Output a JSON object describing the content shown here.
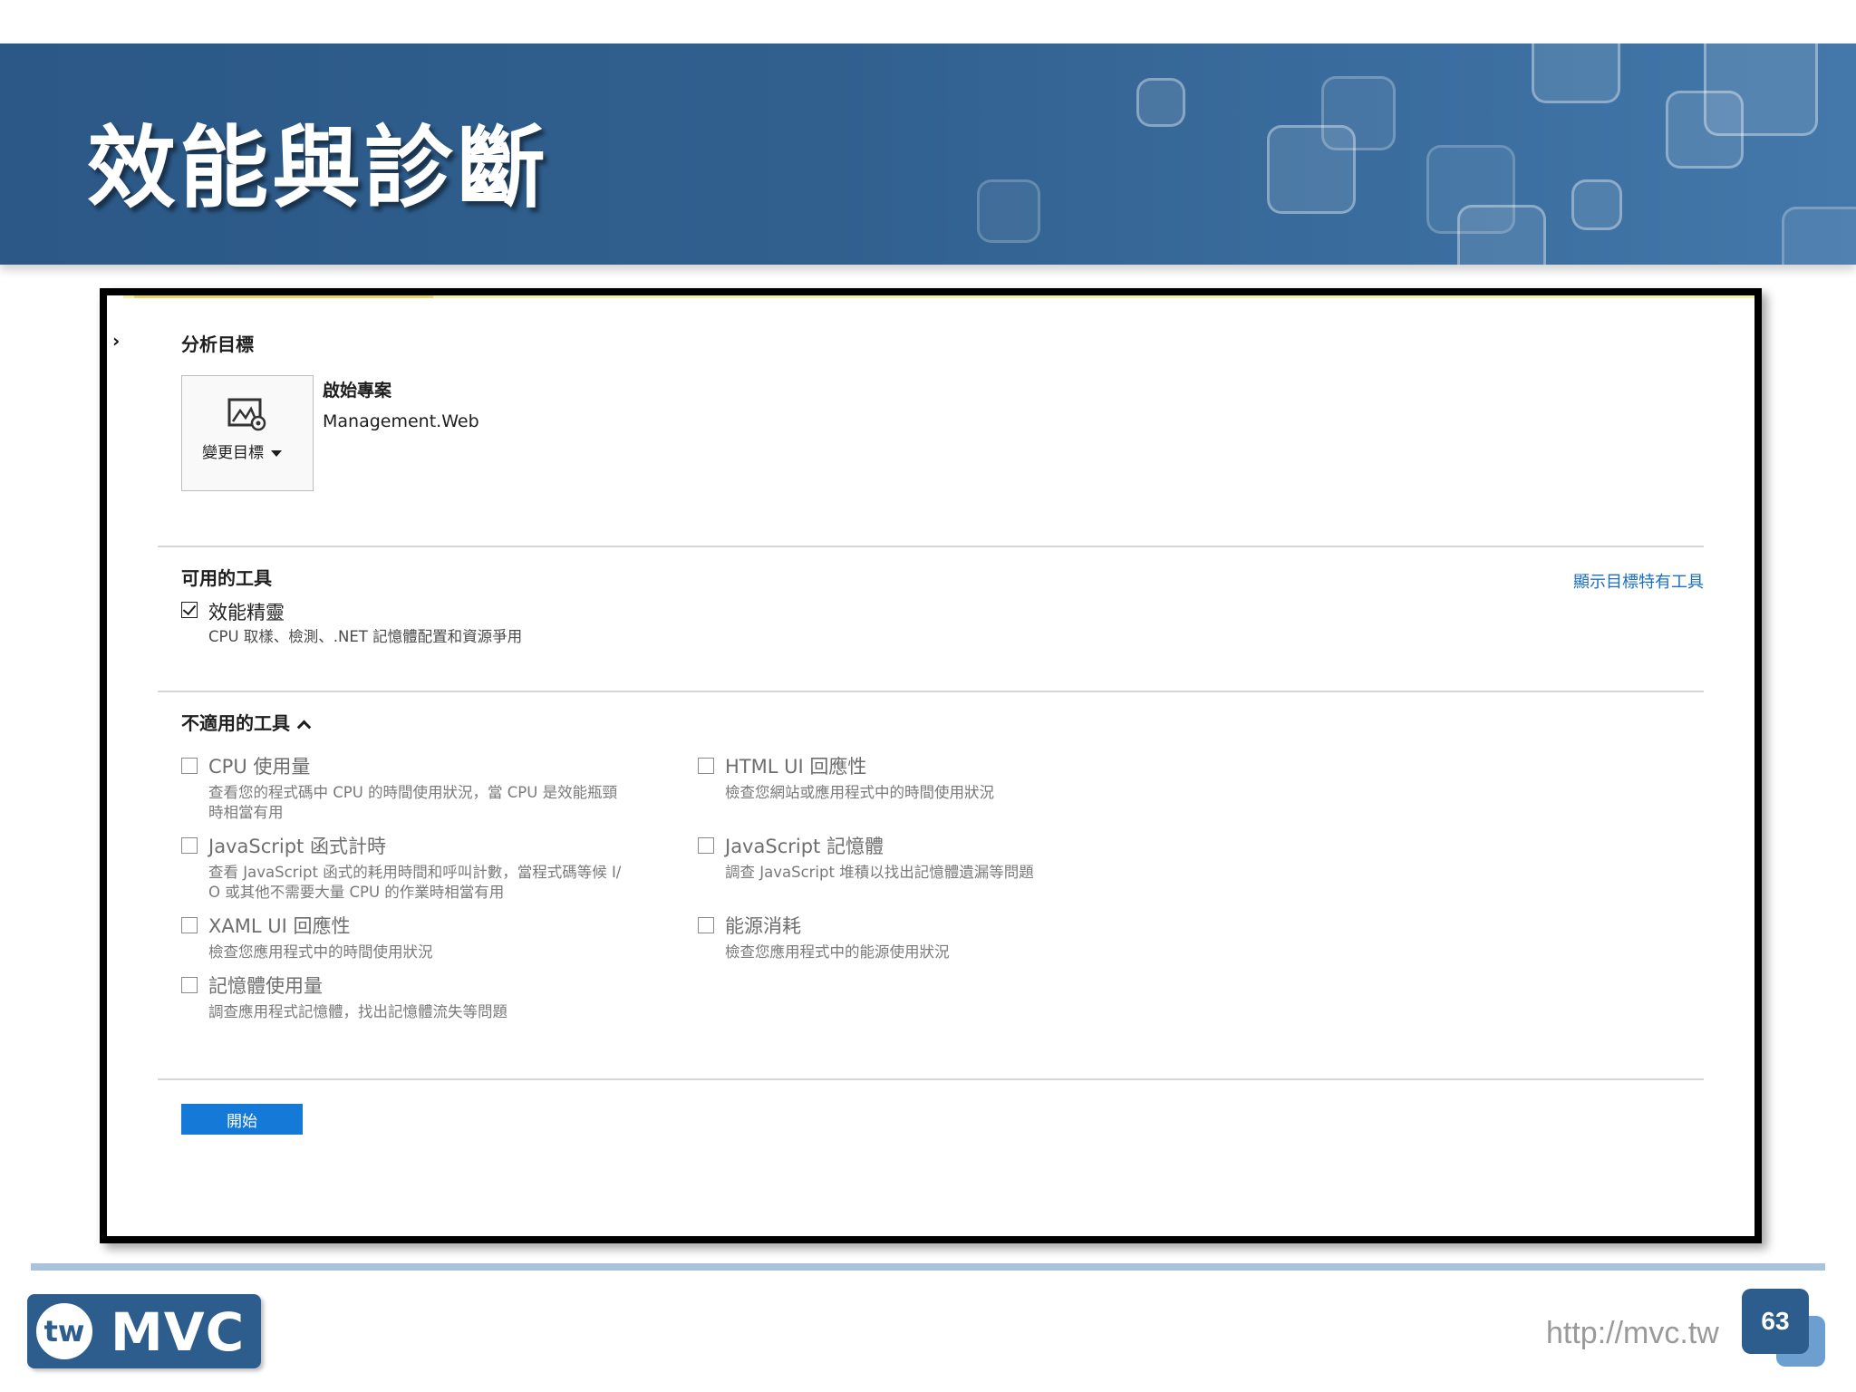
{
  "slide": {
    "title": "效能與診斷",
    "url": "http://mvc.tw",
    "page_number": "63",
    "logo_text": {
      "tw": "tw",
      "mvc": "MVC"
    }
  },
  "analysis_target": {
    "heading": "分析目標",
    "change_target_label": "變更目標",
    "startup_project_label": "啟始專案",
    "project_name": "Management.Web"
  },
  "available_tools": {
    "heading": "可用的工具",
    "show_all_link": "顯示目標特有工具",
    "items": [
      {
        "label": "效能精靈",
        "description": "CPU 取樣、檢測、.NET 記憶體配置和資源爭用",
        "checked": true
      }
    ]
  },
  "unavailable_tools": {
    "heading": "不適用的工具",
    "left_column": [
      {
        "label": "CPU 使用量",
        "description_lines": [
          "查看您的程式碼中 CPU 的時間使用狀況，當 CPU 是效能瓶頸",
          "時相當有用"
        ]
      },
      {
        "label": "JavaScript 函式計時",
        "description_lines": [
          "查看 JavaScript 函式的耗用時間和呼叫計數，當程式碼等候 I/",
          "O 或其他不需要大量 CPU 的作業時相當有用"
        ]
      },
      {
        "label": "XAML UI 回應性",
        "description_lines": [
          "檢查您應用程式中的時間使用狀況"
        ]
      },
      {
        "label": "記憶體使用量",
        "description_lines": [
          "調查應用程式記憶體，找出記憶體流失等問題"
        ]
      }
    ],
    "right_column": [
      {
        "label": "HTML UI 回應性",
        "description_lines": [
          "檢查您網站或應用程式中的時間使用狀況"
        ]
      },
      {
        "label": "JavaScript 記憶體",
        "description_lines": [
          "調查 JavaScript 堆積以找出記憶體遺漏等問題"
        ]
      },
      {
        "label": "能源消耗",
        "description_lines": [
          "檢查您應用程式中的能源使用狀況"
        ]
      }
    ]
  },
  "start_button_label": "開始",
  "colors": {
    "header_blue": "#2b5886",
    "accent_blue": "#1479d7",
    "link_blue": "#1b6ec2"
  }
}
